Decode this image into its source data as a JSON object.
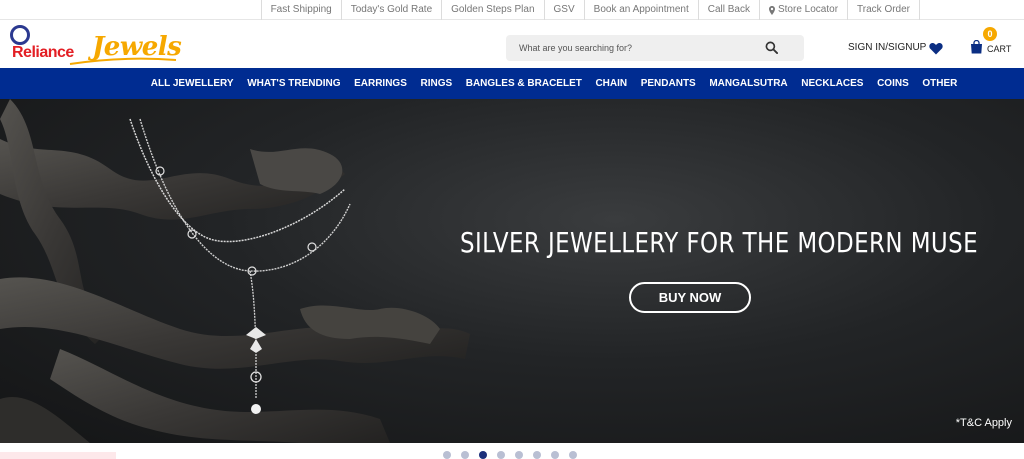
{
  "topbar": {
    "links": [
      "Fast Shipping",
      "Today's Gold Rate",
      "Golden Steps Plan",
      "GSV",
      "Book an Appointment",
      "Call Back",
      "Store Locator",
      "Track Order"
    ]
  },
  "logo": {
    "brand_word1": "Reliance",
    "brand_word2": "Jewels"
  },
  "search": {
    "placeholder": "What are you searching for?"
  },
  "account": {
    "signin_label": "SIGN IN/SIGNUP"
  },
  "cart": {
    "label": "CART",
    "count": "0"
  },
  "nav": {
    "items": [
      "ALL JEWELLERY",
      "WHAT'S TRENDING",
      "EARRINGS",
      "RINGS",
      "BANGLES & BRACELET",
      "CHAIN",
      "PENDANTS",
      "MANGALSUTRA",
      "NECKLACES",
      "COINS",
      "OTHER"
    ]
  },
  "hero": {
    "headline": "SILVER JEWELLERY FOR THE MODERN MUSE",
    "cta_label": "BUY NOW",
    "note": "*T&C Apply"
  },
  "carousel": {
    "slide_count": 8,
    "active_index": 2
  },
  "colors": {
    "nav_bg": "#002c91",
    "brand_red": "#e31e24",
    "brand_gold": "#f6a800",
    "brand_blue": "#2b3990"
  },
  "icons": [
    "map-pin-icon",
    "search-icon",
    "heart-icon",
    "shopping-bag-icon"
  ]
}
